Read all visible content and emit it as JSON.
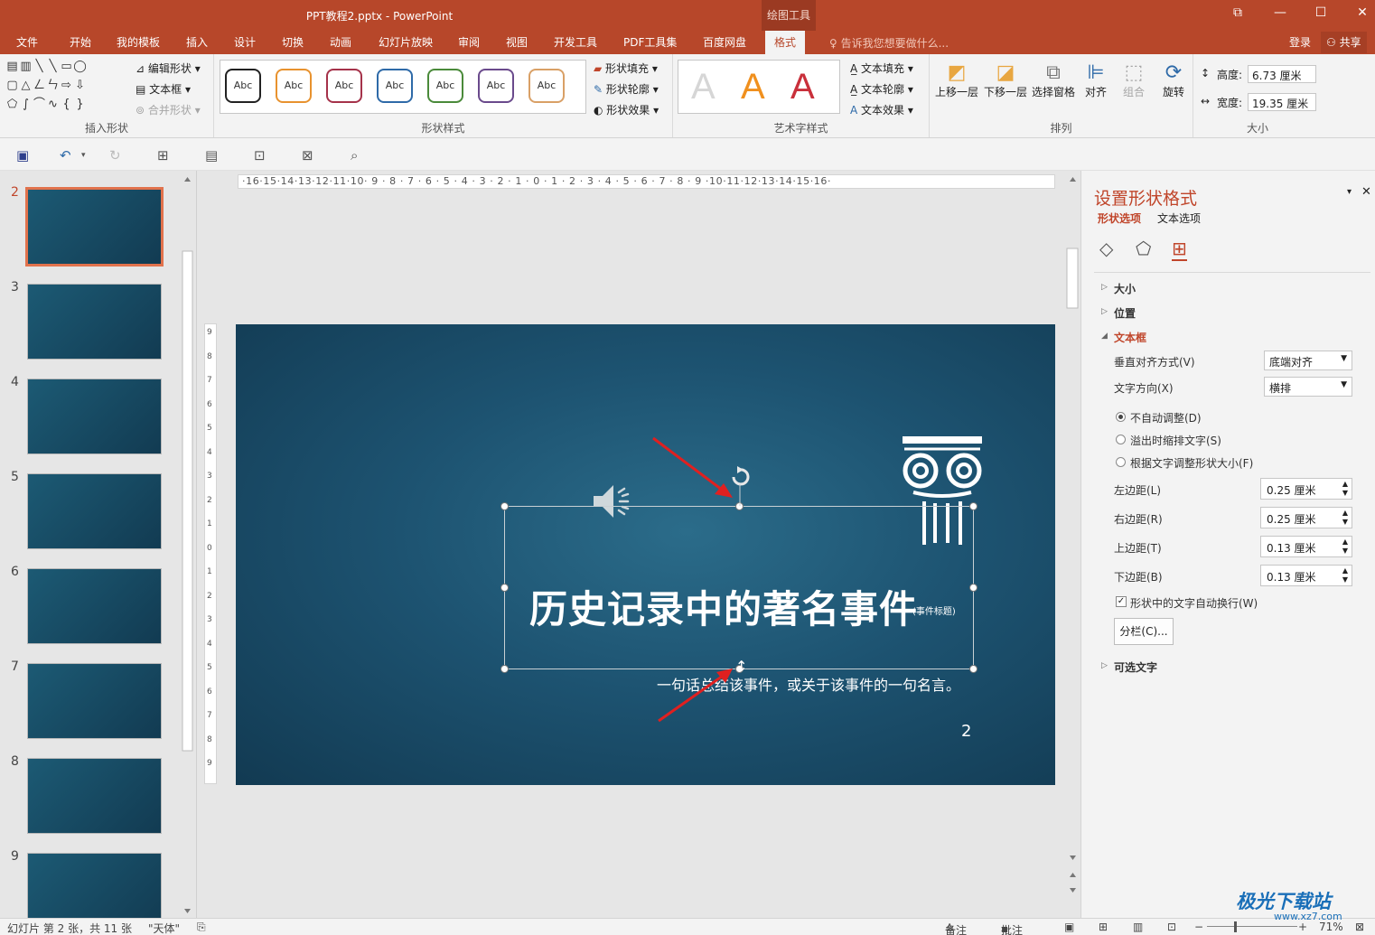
{
  "window": {
    "title": "PPT教程2.pptx - PowerPoint",
    "context_tab_group": "绘图工具",
    "btn_restore_icon": "⧉",
    "btn_minimize": "—",
    "btn_maximize": "☐",
    "btn_close": "✕"
  },
  "tabs": [
    "文件",
    "开始",
    "我的模板",
    "插入",
    "设计",
    "切换",
    "动画",
    "幻灯片放映",
    "审阅",
    "视图",
    "开发工具",
    "PDF工具集",
    "百度网盘",
    "格式"
  ],
  "active_tab": "格式",
  "tell_me": "告诉我您想要做什么...",
  "login": "登录",
  "share": "共享",
  "ribbon": {
    "insert_shapes": {
      "label": "插入形状",
      "edit_shape": "编辑形状",
      "text_box": "文本框",
      "merge_shapes": "合并形状"
    },
    "shape_styles": {
      "label": "形状样式",
      "swatch_text": "Abc",
      "swatch_colors": [
        "#222222",
        "#e8922e",
        "#a5324a",
        "#2e6aa8",
        "#4a8a3a",
        "#6a4a8c",
        "#d9a066"
      ],
      "shape_fill": "形状填充",
      "shape_outline": "形状轮廓",
      "shape_effects": "形状效果"
    },
    "wordart": {
      "label": "艺术字样式",
      "letter": "A",
      "letter_colors": [
        "#d6d6d6",
        "#f0901e",
        "#c9303b"
      ],
      "text_fill": "文本填充",
      "text_outline": "文本轮廓",
      "text_effects": "文本效果"
    },
    "arrange": {
      "label": "排列",
      "bring_forward": "上移一层",
      "send_backward": "下移一层",
      "selection_pane": "选择窗格",
      "align": "对齐",
      "group": "组合",
      "rotate": "旋转"
    },
    "size": {
      "label": "大小",
      "height_label": "高度:",
      "height_value": "6.73 厘米",
      "width_label": "宽度:",
      "width_value": "19.35 厘米"
    }
  },
  "thumbnails": {
    "numbers": [
      "2",
      "3",
      "4",
      "5",
      "6",
      "7",
      "8",
      "9"
    ],
    "selected": "2"
  },
  "ruler": {
    "horizontal": "·16·15·14·13·12·11·10· 9 · 8 · 7 · 6 · 5 · 4 · 3 · 2 · 1 · 0 · 1 · 2 · 3 · 4 · 5 · 6 · 7 · 8 · 9 ·10·11·12·13·14·15·16·"
  },
  "slide": {
    "title": "历史记录中的著名事件",
    "title_note": "(事件标题)",
    "subtitle": "一句话总结该事件，或关于该事件的一句名言。",
    "page_number": "2",
    "icons": [
      "speaker-icon",
      "ionic-column-icon"
    ]
  },
  "format_pane": {
    "title": "设置形状格式",
    "tab_shape": "形状选项",
    "tab_text": "文本选项",
    "sections": {
      "size": "大小",
      "position": "位置",
      "textbox": "文本框",
      "alt_text": "可选文字"
    },
    "vertical_align_label": "垂直对齐方式(V)",
    "vertical_align_value": "底端对齐",
    "text_direction_label": "文字方向(X)",
    "text_direction_value": "横排",
    "autofit_options": [
      "不自动调整(D)",
      "溢出时缩排文字(S)",
      "根据文字调整形状大小(F)"
    ],
    "autofit_selected": "不自动调整(D)",
    "margin_left_label": "左边距(L)",
    "margin_left_value": "0.25 厘米",
    "margin_right_label": "右边距(R)",
    "margin_right_value": "0.25 厘米",
    "margin_top_label": "上边距(T)",
    "margin_top_value": "0.13 厘米",
    "margin_bottom_label": "下边距(B)",
    "margin_bottom_value": "0.13 厘米",
    "wrap_text_label": "形状中的文字自动换行(W)",
    "wrap_text_checked": true,
    "columns_button": "分栏(C)..."
  },
  "status": {
    "slide_info": "幻灯片 第 2 张，共 11 张",
    "theme": "\"天体\"",
    "notes": "备注",
    "comments": "批注",
    "zoom": "71%"
  },
  "watermark": {
    "brand": "极光下载站",
    "url": "www.xz7.com"
  },
  "colors": {
    "accent": "#b7472a",
    "slide_bg": "#1d5371",
    "annotation_arrow": "#e02020"
  }
}
